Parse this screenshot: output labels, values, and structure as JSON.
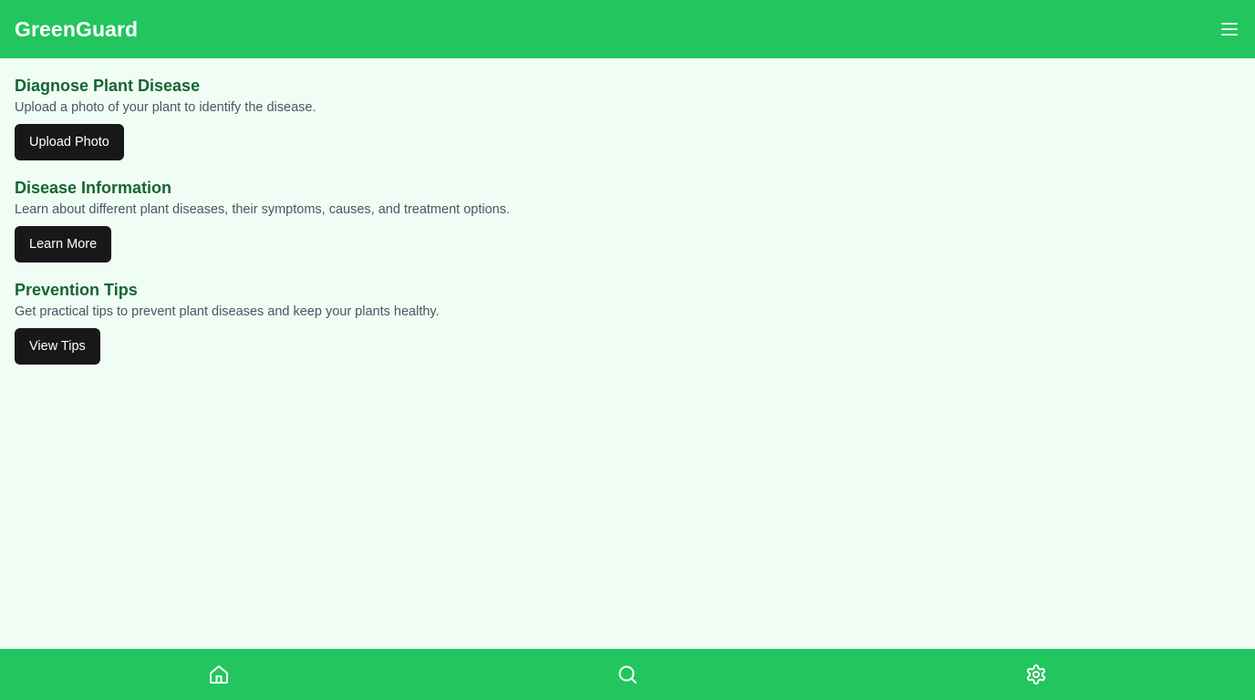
{
  "header": {
    "title": "GreenGuard",
    "menu_icon": "menu-icon"
  },
  "sections": [
    {
      "title": "Diagnose Plant Disease",
      "description": "Upload a photo of your plant to identify the disease.",
      "button_label": "Upload Photo"
    },
    {
      "title": "Disease Information",
      "description": "Learn about different plant diseases, their symptoms, causes, and treatment options.",
      "button_label": "Learn More"
    },
    {
      "title": "Prevention Tips",
      "description": "Get practical tips to prevent plant diseases and keep your plants healthy.",
      "button_label": "View Tips"
    }
  ],
  "bottom_nav": {
    "items": [
      {
        "icon": "home-icon"
      },
      {
        "icon": "search-icon"
      },
      {
        "icon": "gear-icon"
      }
    ]
  },
  "colors": {
    "brand_green": "#22c55e",
    "background": "#f0fdf4",
    "heading_green": "#166534",
    "button_dark": "#18181b",
    "text_muted": "#4b5563"
  }
}
